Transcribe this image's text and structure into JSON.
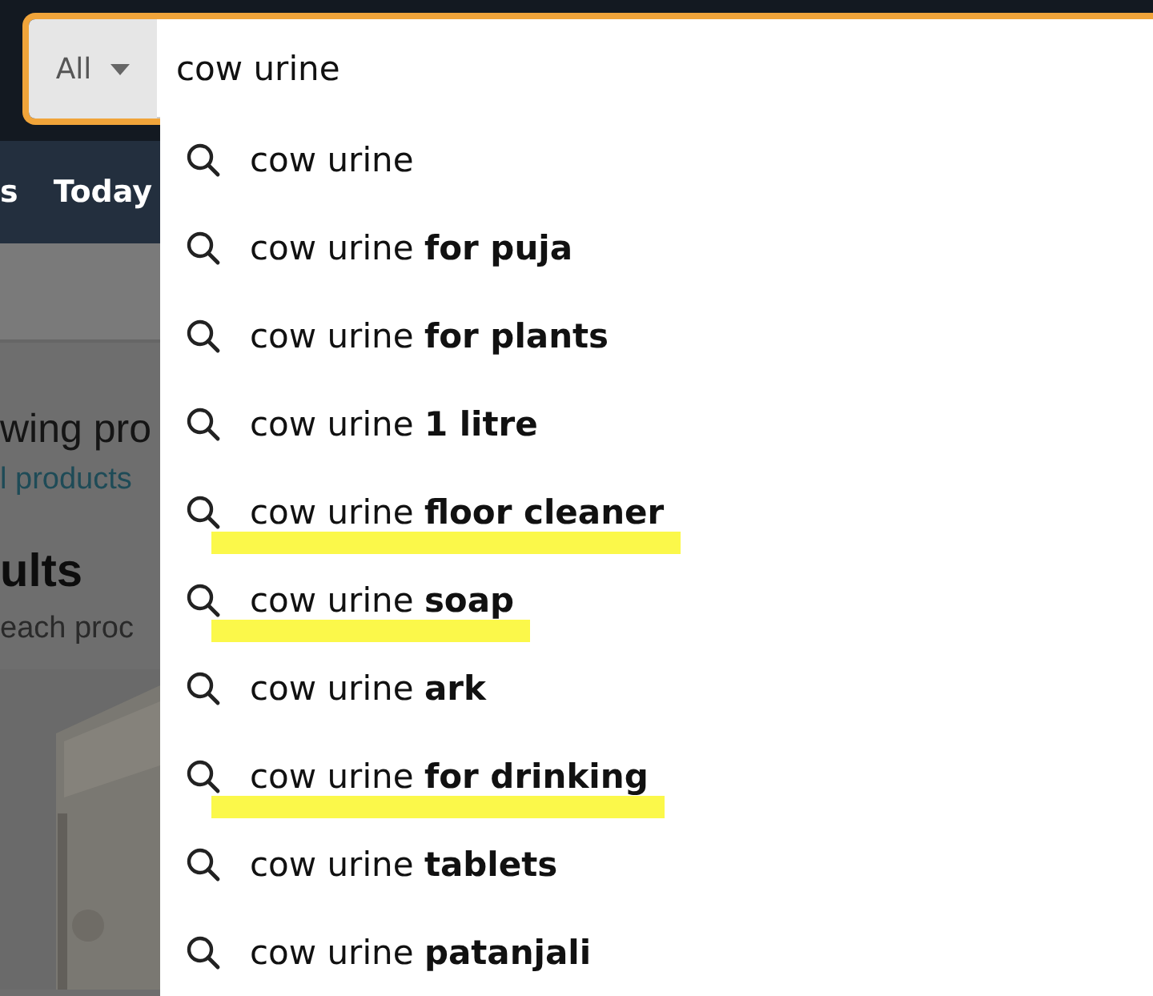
{
  "search": {
    "category": "All",
    "value": "cow urine"
  },
  "nav": {
    "items": [
      "s",
      "Today"
    ]
  },
  "page": {
    "heading": "wing pro",
    "link": "l products",
    "results_title": "ults",
    "results_note": "each proc"
  },
  "suggestions": [
    {
      "text": "cow urine",
      "highlighted": false
    },
    {
      "text": "cow urine **for puja**",
      "highlighted": false
    },
    {
      "text": "cow urine **for plants**",
      "highlighted": false
    },
    {
      "text": "cow urine **1 litre**",
      "highlighted": false
    },
    {
      "text": "cow urine **floor cleaner**",
      "highlighted": true
    },
    {
      "text": "cow urine **soap**",
      "highlighted": true
    },
    {
      "text": "cow urine **ark**",
      "highlighted": false
    },
    {
      "text": "cow urine **for drinking**",
      "highlighted": true
    },
    {
      "text": "cow urine **tablets**",
      "highlighted": false
    },
    {
      "text": "cow urine **patanjali**",
      "highlighted": false
    }
  ]
}
